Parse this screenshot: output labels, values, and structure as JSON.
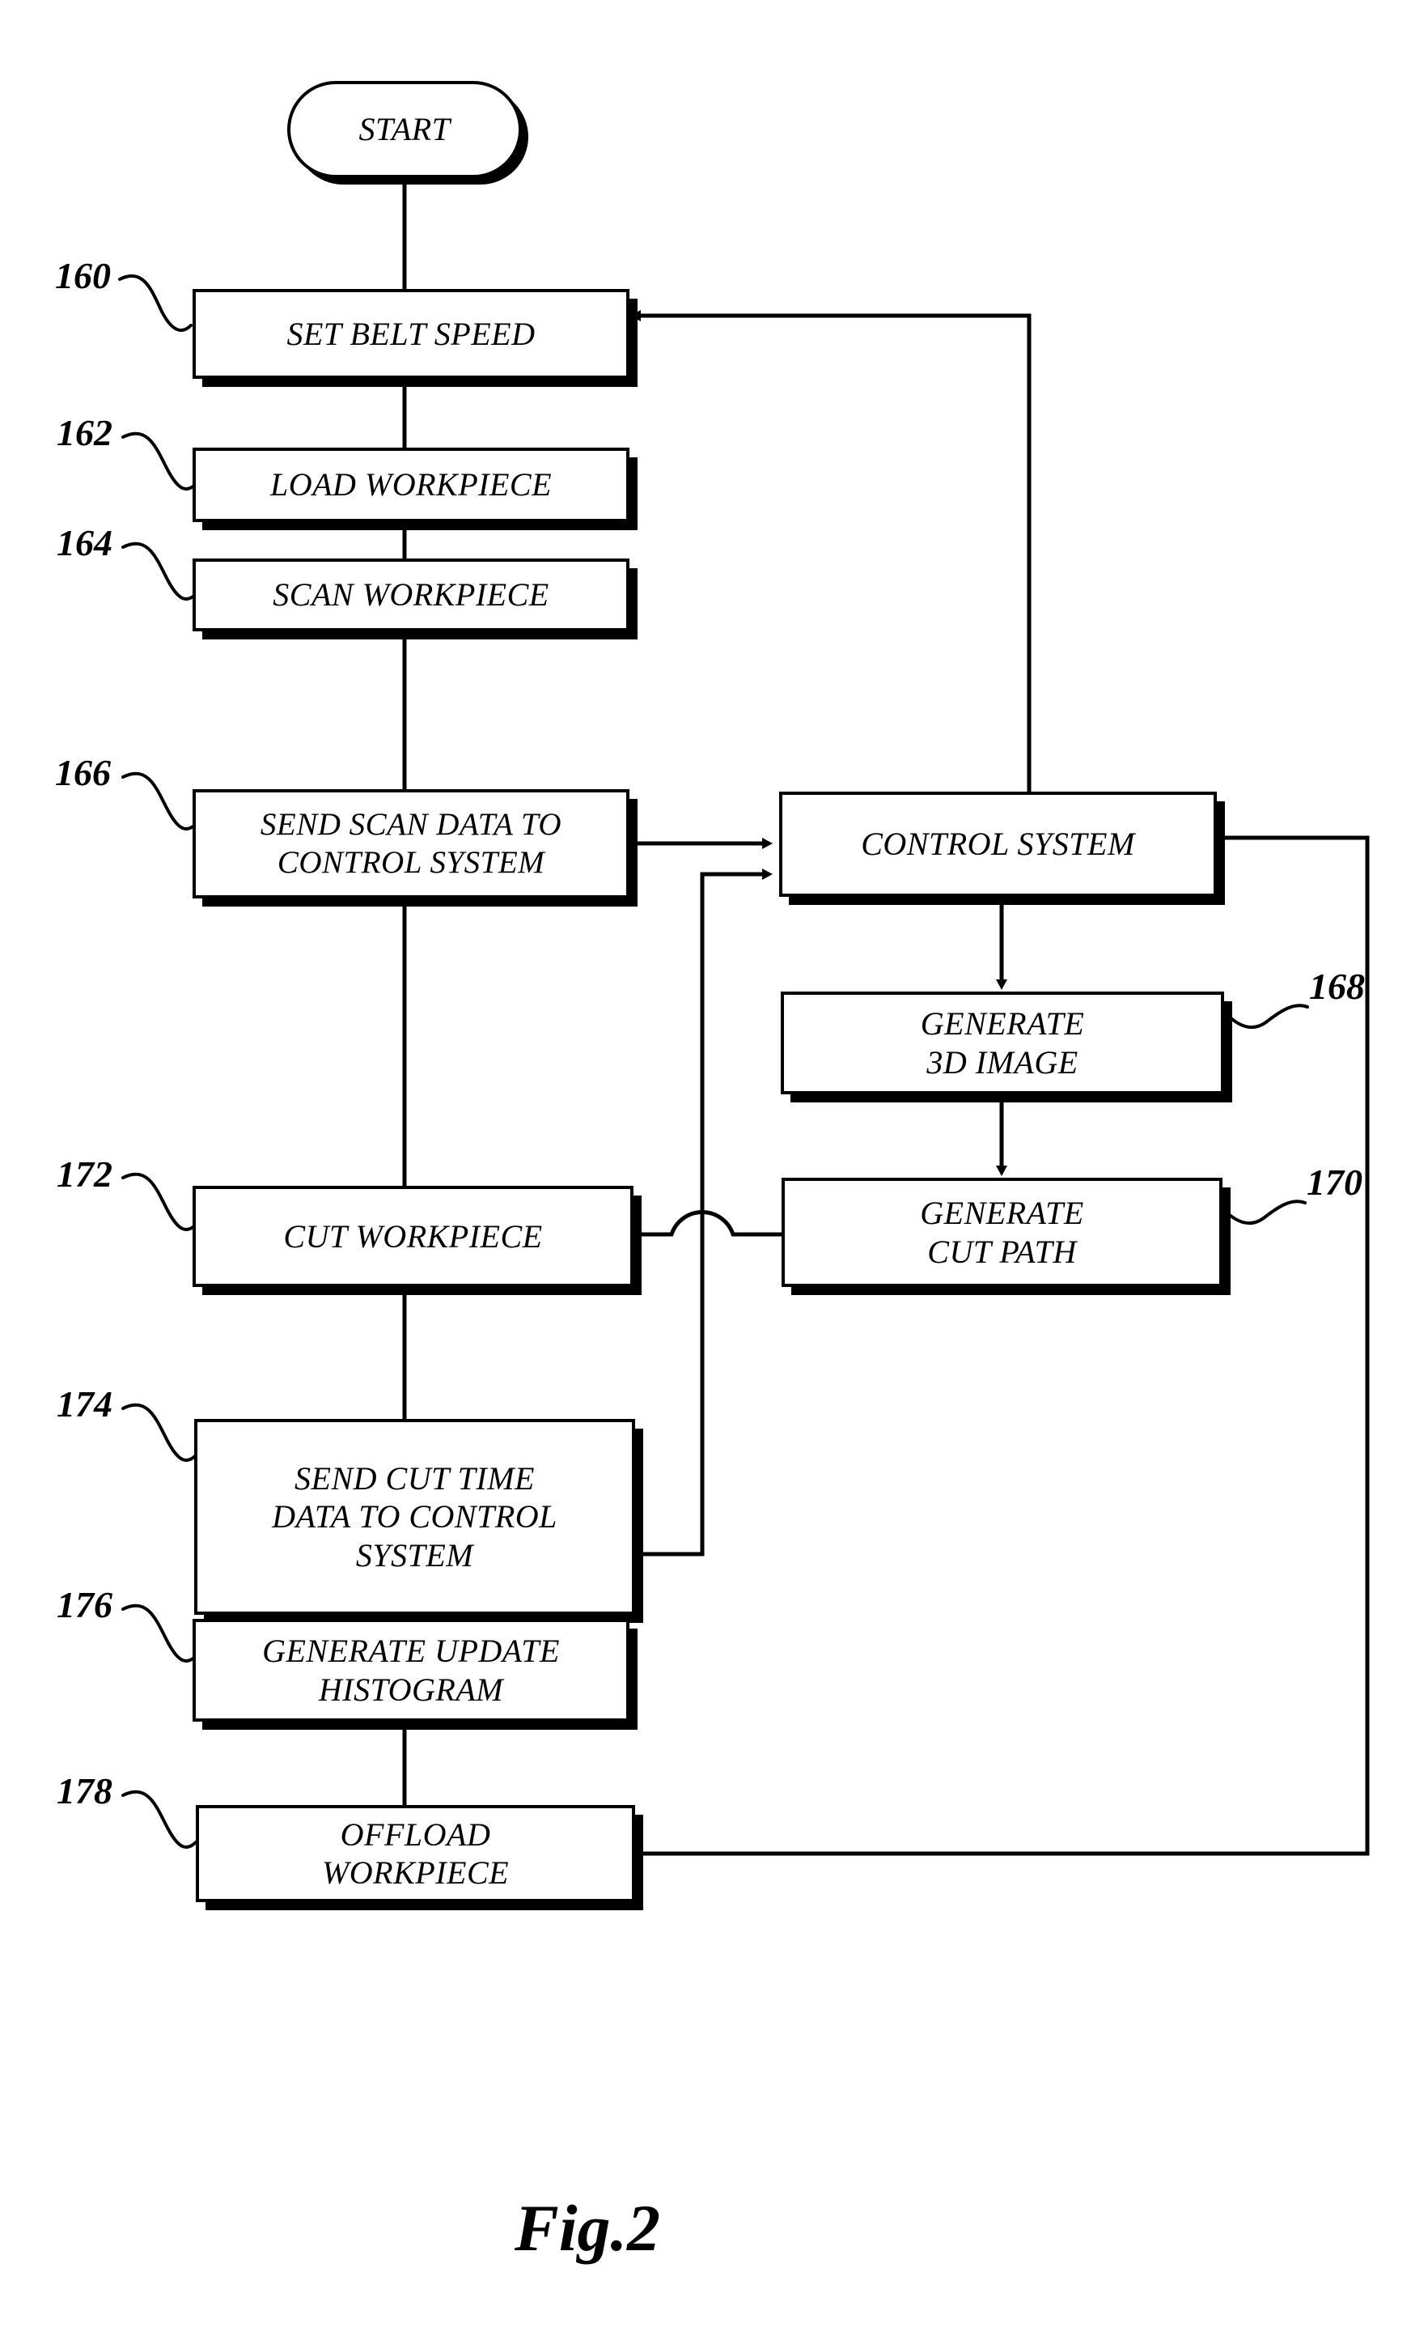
{
  "figure": {
    "caption": "Fig.2",
    "title_number": "2"
  },
  "nodes": {
    "start": {
      "label": "START",
      "shape": "terminator"
    },
    "set_belt_speed": {
      "label": "SET BELT SPEED",
      "ref": "160"
    },
    "load_workpiece": {
      "label": "LOAD WORKPIECE",
      "ref": "162"
    },
    "scan_workpiece": {
      "label": "SCAN WORKPIECE",
      "ref": "164"
    },
    "send_scan_data": {
      "label": "SEND SCAN DATA TO\nCONTROL SYSTEM",
      "ref": "166"
    },
    "control_system": {
      "label": "CONTROL SYSTEM"
    },
    "generate_3d_image": {
      "label": "GENERATE\n3D IMAGE",
      "ref": "168"
    },
    "generate_cut_path": {
      "label": "GENERATE\nCUT PATH",
      "ref": "170"
    },
    "cut_workpiece": {
      "label": "CUT WORKPIECE",
      "ref": "172"
    },
    "send_cut_time_data": {
      "label": "SEND CUT TIME\nDATA TO CONTROL\nSYSTEM",
      "ref": "174"
    },
    "generate_update_histogram": {
      "label": "GENERATE UPDATE\nHISTOGRAM",
      "ref": "176"
    },
    "offload_workpiece": {
      "label": "OFFLOAD\nWORKPIECE",
      "ref": "178"
    }
  },
  "refs": {
    "r160": "160",
    "r162": "162",
    "r164": "164",
    "r166": "166",
    "r168": "168",
    "r170": "170",
    "r172": "172",
    "r174": "174",
    "r176": "176",
    "r178": "178"
  },
  "colors": {
    "ink": "#000000",
    "paper": "#ffffff"
  }
}
